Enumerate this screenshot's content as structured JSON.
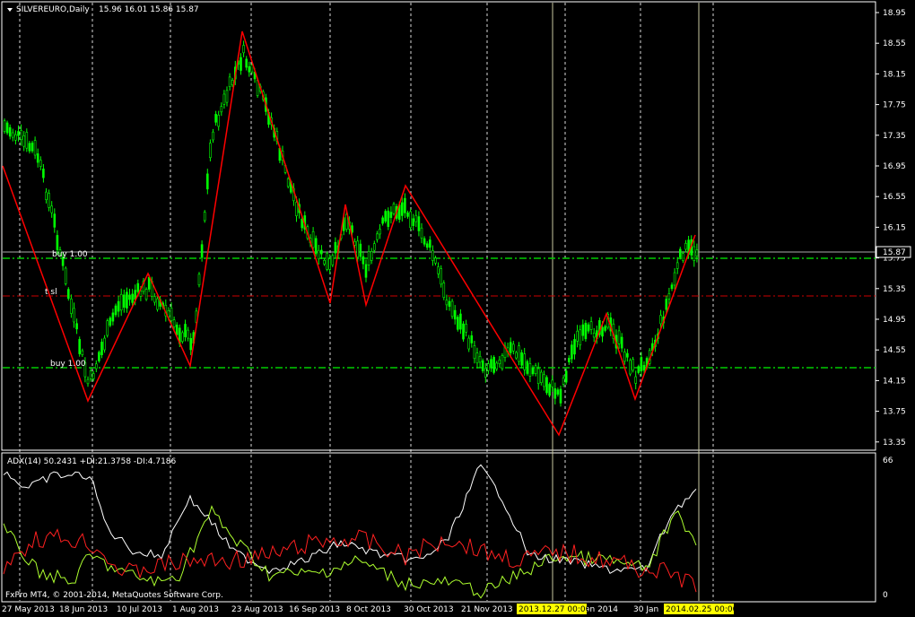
{
  "window": {
    "title": "SILVEREURO,Daily",
    "ohlc": "15.96 16.01 15.86 15.87"
  },
  "indicator": {
    "label": "ADX(14) 50.2431 +DI:21.3758 -DI:4.7186",
    "scale_max": "66",
    "scale_min": "0"
  },
  "copyright": "FxPro MT4, © 2001-2014, MetaQuotes Software Corp.",
  "current_price": "15.87",
  "orders": [
    {
      "label": "buy 1.00",
      "price": 15.78
    },
    {
      "label": "t sl",
      "price": 15.28
    },
    {
      "label": "buy 1.00",
      "price": 14.35
    }
  ],
  "price_axis": [
    "18.95",
    "18.55",
    "18.15",
    "17.75",
    "17.35",
    "16.95",
    "16.55",
    "16.15",
    "15.75",
    "15.35",
    "14.95",
    "14.55",
    "14.15",
    "13.75",
    "13.35"
  ],
  "date_axis": [
    "27 May 2013",
    "18 Jun 2013",
    "10 Jul 2013",
    "1 Aug 2013",
    "23 Aug 2013",
    "16 Sep 2013",
    "8 Oct 2013",
    "30 Oct 2013",
    "21 Nov 2013",
    "an 2014",
    "30 Jan"
  ],
  "crosshair_tags": [
    "2013.12.27 00:00",
    "2014.02.25 00:00"
  ],
  "colors": {
    "background": "#000000",
    "candle": "#00ff00",
    "zigzag": "#ff0000",
    "order_line": "#00cc00",
    "sl_line": "#cc0000",
    "adx": "#ffffff",
    "plus_di": "#adff2f",
    "minus_di": "#ff0000",
    "tag_bg": "#ffff00"
  }
}
